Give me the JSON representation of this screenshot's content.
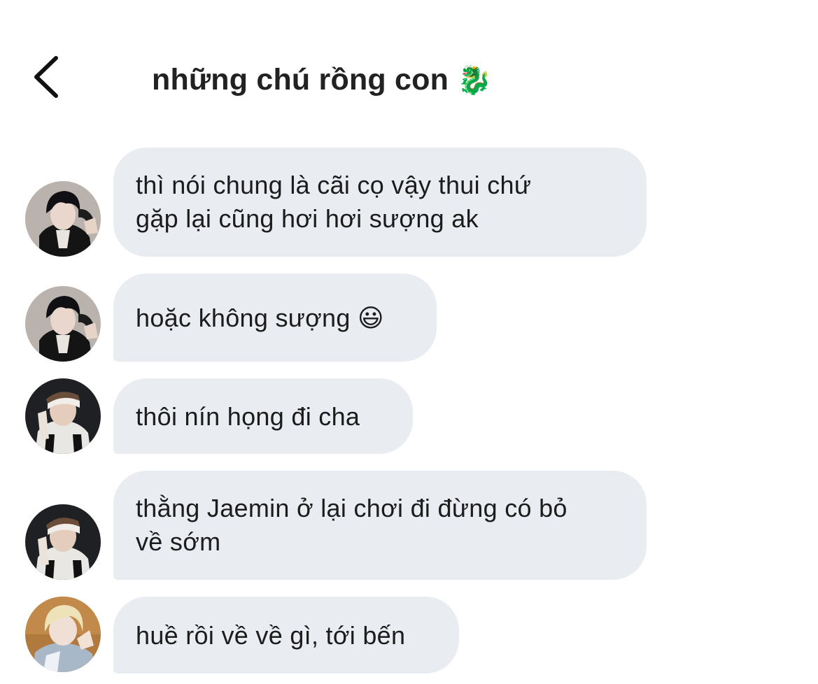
{
  "header": {
    "title": "những chú rồng con",
    "title_emoji": "🐉"
  },
  "messages": [
    {
      "text": "thì nói chung là cãi cọ vậy thui chứ\ngặp lại cũng hơi hơi sượng ak",
      "sender_avatar": "avatar-dark-hair"
    },
    {
      "text": "hoặc không sượng 😃",
      "sender_avatar": "avatar-dark-hair"
    },
    {
      "text": "thôi nín họng đi cha",
      "sender_avatar": "avatar-headband"
    },
    {
      "text": "thằng Jaemin ở lại chơi đi đừng có bỏ\nvề sớm",
      "sender_avatar": "avatar-headband"
    },
    {
      "text": "huề rồi về về gì, tới bến",
      "sender_avatar": "avatar-blonde"
    }
  ],
  "colors": {
    "bubble_bg": "#e9ecf1",
    "text": "#1c1c1c",
    "background": "#ffffff"
  }
}
